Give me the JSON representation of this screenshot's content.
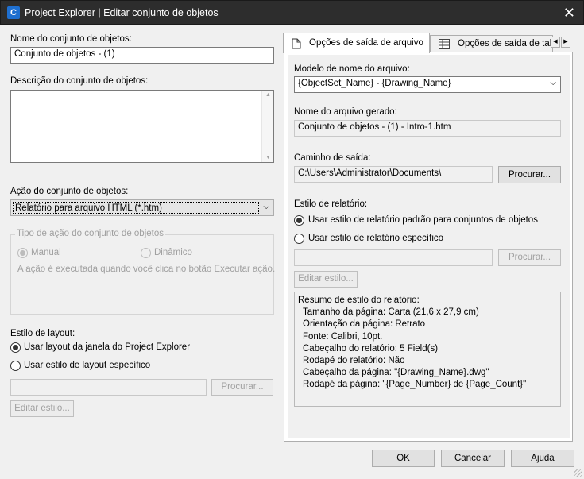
{
  "window": {
    "title": "Project Explorer | Editar conjunto de objetos",
    "app_icon_letter": "C",
    "close_glyph": "✕"
  },
  "left": {
    "name_label": "Nome do conjunto de objetos:",
    "name_value": "Conjunto de objetos - (1)",
    "description_label": "Descrição do conjunto de objetos:",
    "description_value": "",
    "action_label": "Ação do conjunto de objetos:",
    "action_value": "Relatório para arquivo HTML (*.htm)",
    "action_type_group": {
      "legend": "Tipo de ação do conjunto de objetos",
      "manual_label": "Manual",
      "dynamic_label": "Dinâmico",
      "selected": "manual",
      "description": "A ação é executada quando você clica no botão Executar ação."
    },
    "layout_label": "Estilo de layout:",
    "layout_option_1": "Usar layout da janela do Project Explorer",
    "layout_option_2": "Usar estilo de layout específico",
    "layout_selected": 1,
    "layout_path_value": "",
    "browse_button": "Procurar...",
    "edit_style_button": "Editar estilo..."
  },
  "tabs": [
    {
      "label": "Opções de saída de arquivo",
      "icon": "file-icon",
      "active": true
    },
    {
      "label": "Opções de saída de tabela",
      "icon": "table-icon",
      "active": false
    }
  ],
  "tab_scroll": {
    "left": "◀",
    "right": "▶"
  },
  "file_output": {
    "file_name_model_label": "Modelo de nome do arquivo:",
    "file_name_model_value": "{ObjectSet_Name} - {Drawing_Name}",
    "generated_name_label": "Nome do arquivo gerado:",
    "generated_name_value": "Conjunto de objetos - (1) - Intro-1.htm",
    "output_path_label": "Caminho de saída:",
    "output_path_value": "C:\\Users\\Administrator\\Documents\\",
    "browse_button": "Procurar...",
    "report_style_label": "Estilo de relatório:",
    "report_option_1": "Usar estilo de relatório padrão para conjuntos de objetos",
    "report_option_2": "Usar estilo de relatório específico",
    "report_selected": 1,
    "style_path_value": "",
    "browse_button_2": "Procurar...",
    "edit_style_button": "Editar estilo...",
    "summary": {
      "title": "Resumo de estilo do relatório:",
      "lines": [
        "Tamanho da página: Carta (21,6 x 27,9 cm)",
        "Orientação da página: Retrato",
        "Fonte: Calibri, 10pt.",
        "Cabeçalho do relatório: 5 Field(s)",
        "Rodapé do relatório: Não",
        "Cabeçalho da página: \"{Drawing_Name}.dwg\"",
        "Rodapé da página: \"{Page_Number} de {Page_Count}\""
      ]
    }
  },
  "footer": {
    "ok_button": "OK",
    "cancel_button": "Cancelar",
    "help_button": "Ajuda"
  }
}
